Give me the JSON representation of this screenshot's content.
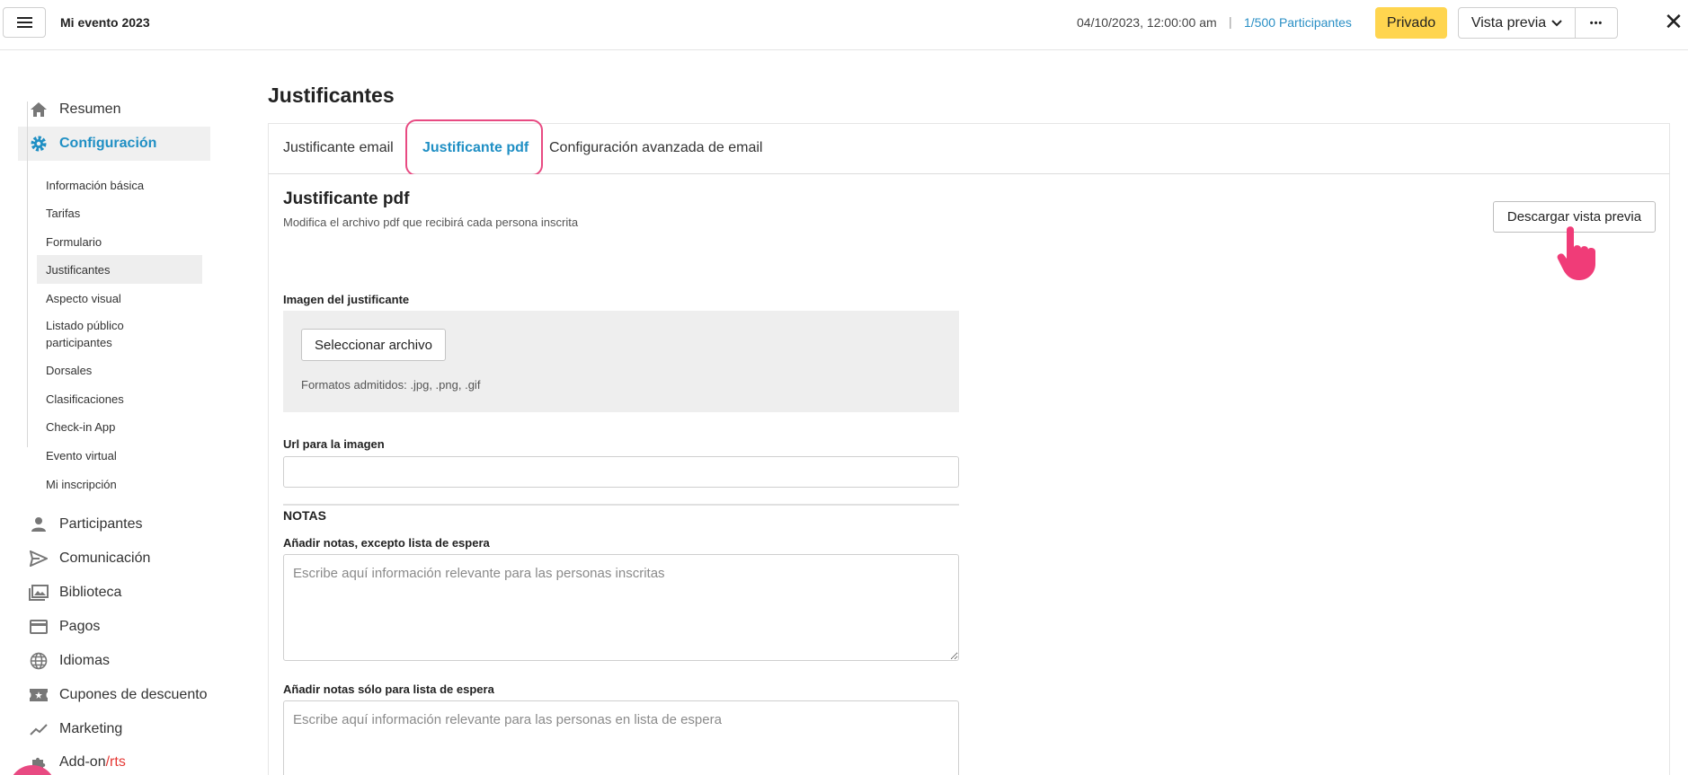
{
  "header": {
    "event_title": "Mi evento 2023",
    "event_date": "04/10/2023, 12:00:00 am",
    "separator": "|",
    "participants_count": "1/500",
    "participants_label": "Participantes",
    "private_label": "Privado",
    "preview_label": "Vista previa",
    "more_label": "•••",
    "close_label": "✕"
  },
  "sidebar": {
    "items": [
      {
        "label": "Resumen",
        "icon": "home-icon"
      },
      {
        "label": "Configuración",
        "icon": "gear-icon",
        "active": true
      },
      {
        "label": "Participantes",
        "icon": "person-icon"
      },
      {
        "label": "Comunicación",
        "icon": "send-icon"
      },
      {
        "label": "Biblioteca",
        "icon": "gallery-icon"
      },
      {
        "label": "Pagos",
        "icon": "card-icon"
      },
      {
        "label": "Idiomas",
        "icon": "globe-icon"
      },
      {
        "label": "Cupones de descuento",
        "icon": "ticket-icon"
      },
      {
        "label": "Marketing",
        "icon": "trend-icon"
      },
      {
        "label_prefix": "Add-on",
        "label_suffix": "/rts",
        "icon": "puzzle-icon"
      }
    ],
    "subitems": [
      "Información básica",
      "Tarifas",
      "Formulario",
      "Justificantes",
      "Aspecto visual",
      "Listado público participantes",
      "Dorsales",
      "Clasificaciones",
      "Check-in App",
      "Evento virtual",
      "Mi inscripción"
    ],
    "active_subitem": "Justificantes"
  },
  "main": {
    "page_title": "Justificantes",
    "tabs": [
      {
        "label": "Justificante email"
      },
      {
        "label": "Justificante pdf",
        "active": true
      },
      {
        "label": "Configuración avanzada de email"
      }
    ],
    "section_title": "Justificante pdf",
    "section_subtitle": "Modifica el archivo pdf que recibirá cada persona inscrita",
    "download_label": "Descargar vista previa",
    "image_label": "Imagen del justificante",
    "file_button_label": "Seleccionar archivo",
    "formats_text": "Formatos admitidos: .jpg, .png, .gif",
    "url_label": "Url para la imagen",
    "url_value": "",
    "notes_heading": "NOTAS",
    "notes_label": "Añadir notas, excepto lista de espera",
    "notes_placeholder": "Escribe aquí información relevante para las personas inscritas",
    "waitlist_label": "Añadir notas sólo para lista de espera",
    "waitlist_placeholder": "Escribe aquí información relevante para las personas en lista de espera"
  },
  "colors": {
    "accent": "#1f8fc4",
    "private": "#ffd54f",
    "highlight": "#e84a82",
    "addon_red": "#e53935"
  }
}
